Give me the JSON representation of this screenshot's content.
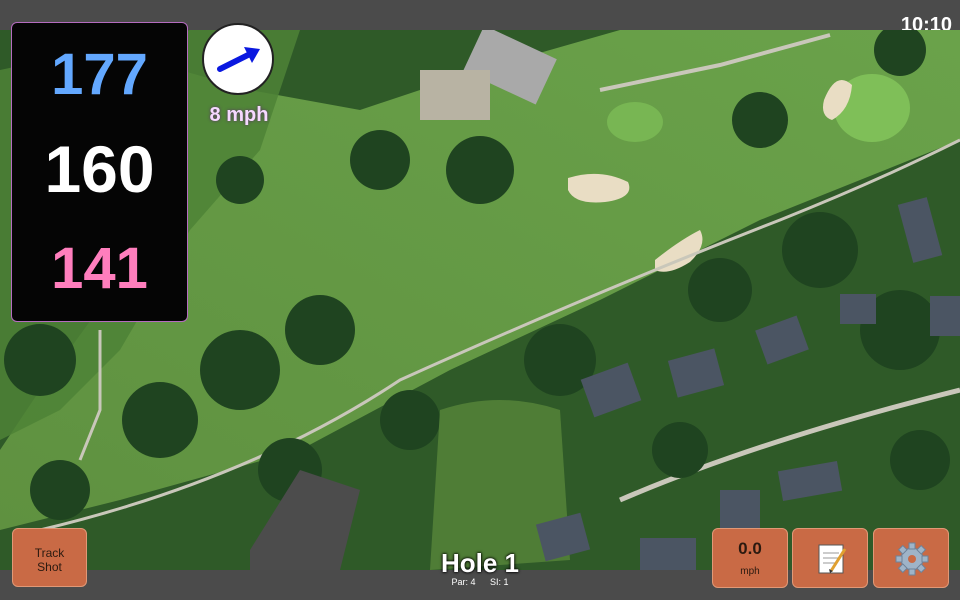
{
  "status": {
    "time": "10:10"
  },
  "distances": {
    "back": "177",
    "middle": "160",
    "front": "141"
  },
  "wind": {
    "speed": "8 mph",
    "icon": "wind-direction-arrow-icon"
  },
  "buttons": {
    "track_shot": {
      "line1": "Track",
      "line2": "Shot"
    },
    "speed": {
      "value": "0.0",
      "unit": "mph"
    },
    "notes_icon": "notepad-icon",
    "settings_icon": "gear-icon"
  },
  "hole": {
    "title": "Hole 1",
    "par": "Par: 4",
    "si": "SI: 1"
  },
  "colors": {
    "accent": "#c96a45",
    "back": "#63a8ff",
    "front": "#ff7ebd",
    "border": "#b56cc0"
  }
}
